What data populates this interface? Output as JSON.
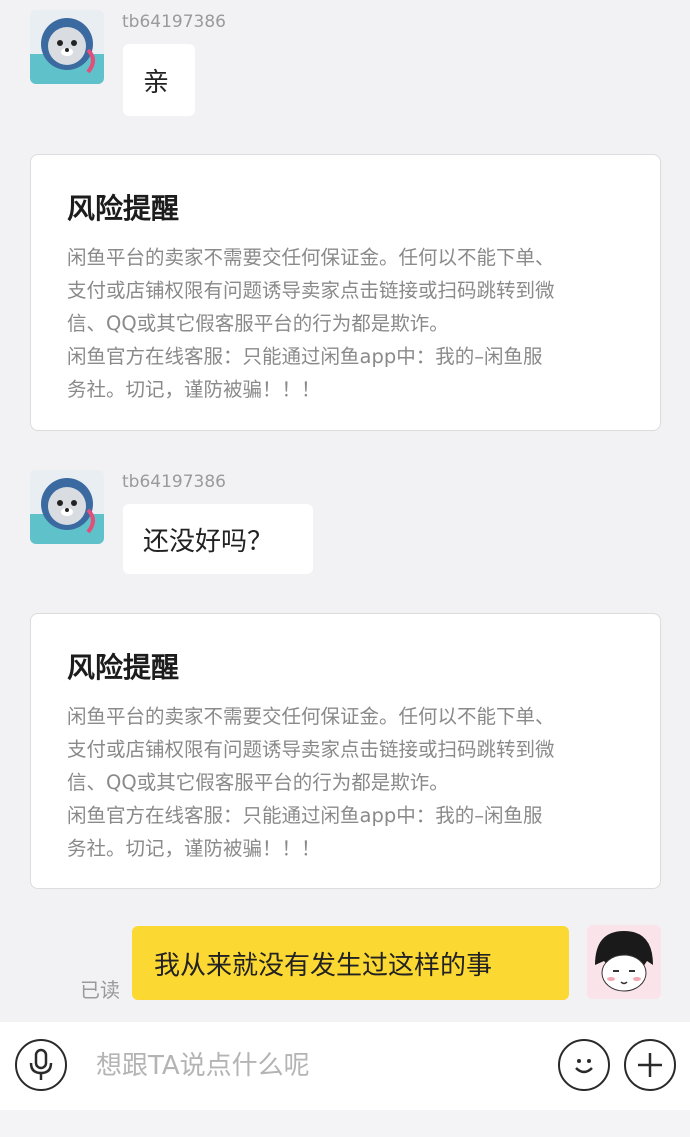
{
  "messages": [
    {
      "username": "tb64197386",
      "text": "亲"
    },
    {
      "username": "tb64197386",
      "text": "还没好吗？"
    }
  ],
  "risk_notice": {
    "title": "风险提醒",
    "lines": [
      "闲鱼平台的卖家不需要交任何保证金。任何以不能下单、",
      "支付或店铺权限有问题诱导卖家点击链接或扫码跳转到微",
      "信、QQ或其它假客服平台的行为都是欺诈。",
      "闲鱼官方在线客服：只能通过闲鱼app中：我的–闲鱼服",
      "务社。切记，谨防被骗！！！"
    ]
  },
  "my_message": {
    "text": "我从来就没有发生过这样的事",
    "status": "已读"
  },
  "input_bar": {
    "placeholder": "想跟TA说点什么呢"
  },
  "colors": {
    "background": "#f2f2f4",
    "my_bubble": "#fcd832",
    "other_bubble": "#ffffff"
  },
  "icons": [
    "voice-icon",
    "emoji-icon",
    "plus-icon"
  ]
}
